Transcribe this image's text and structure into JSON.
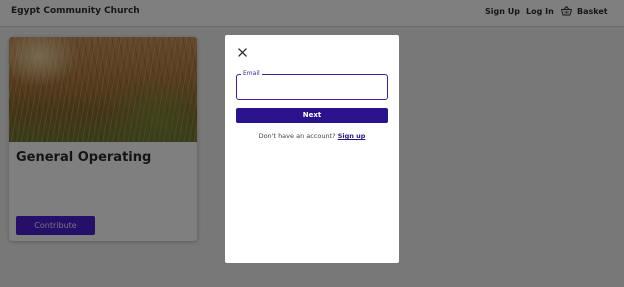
{
  "header": {
    "brand": "Egypt Community Church",
    "nav": {
      "sign_up": "Sign Up",
      "log_in": "Log In",
      "basket": "Basket"
    }
  },
  "fund_card": {
    "title": "General Operating",
    "button_label": "Contribute"
  },
  "modal": {
    "email_label": "Email",
    "email_value": "",
    "next_label": "Next",
    "no_account_text": "Don't have an account?",
    "sign_up_link": "Sign up"
  },
  "colors": {
    "primary": "#2a138c",
    "contribute_button": "#4b1fd0",
    "overlay": "rgba(0,0,0,0.5)"
  },
  "icons": {
    "basket": "basket-icon",
    "close": "close-icon"
  }
}
